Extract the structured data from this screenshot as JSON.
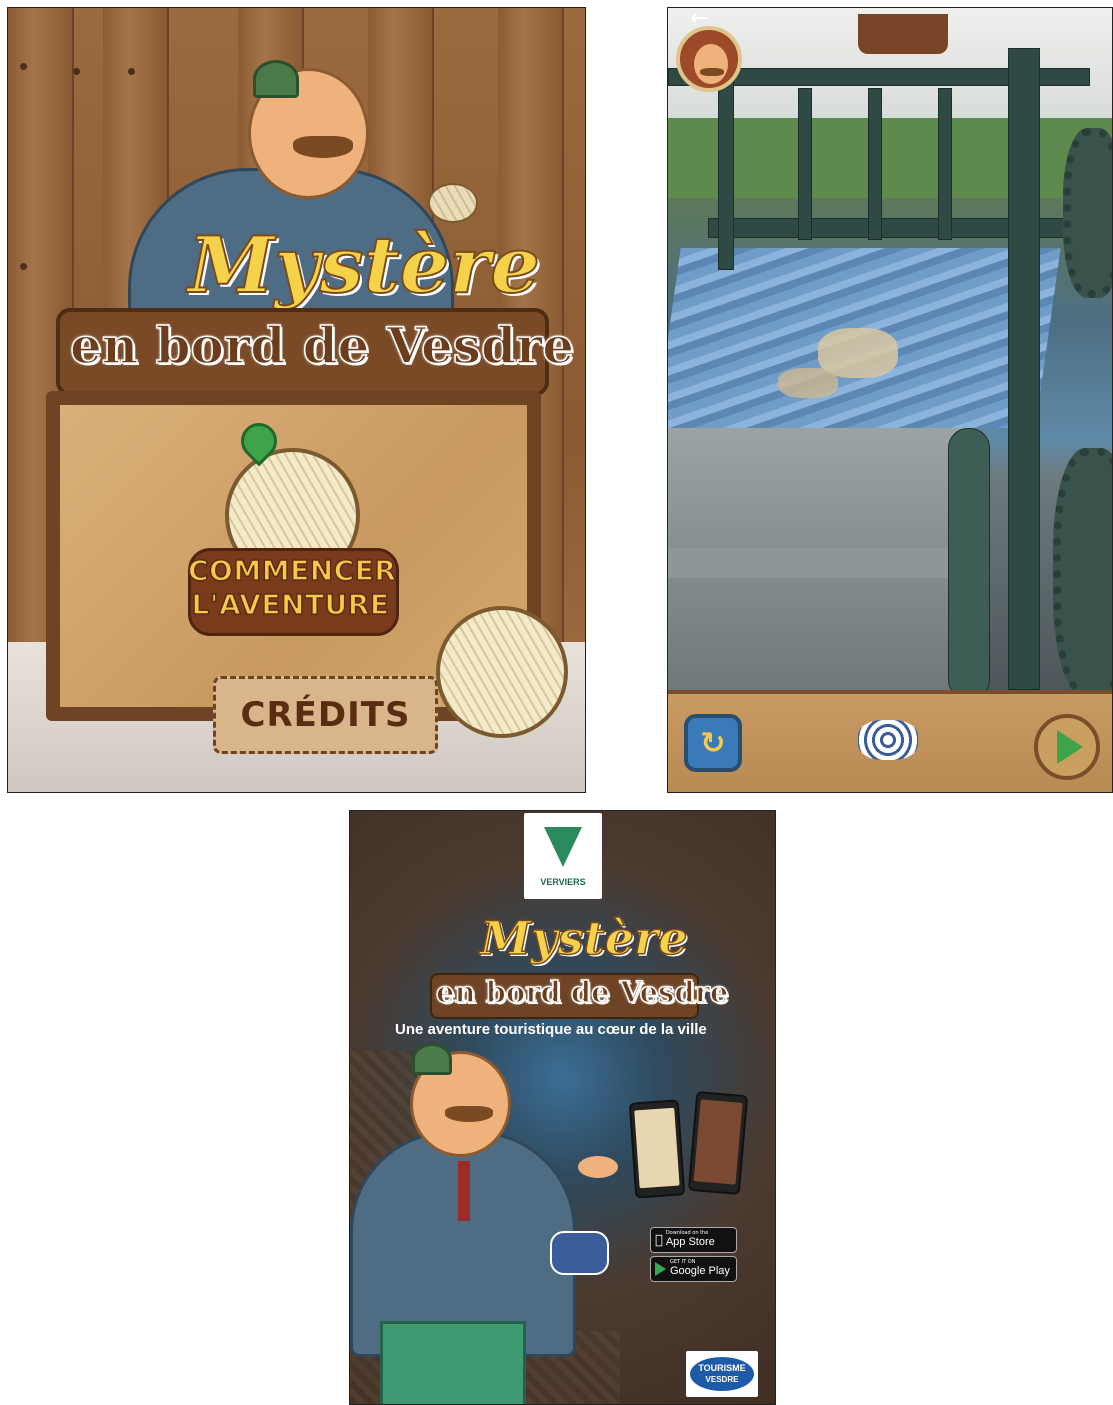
{
  "screen1": {
    "title_script": "Mystère",
    "title_sub": "en bord de Vesdre",
    "start_button_label_line1": "COMMENCER",
    "start_button_label_line2": "L'AVENTURE",
    "credits_label": "CRÉDITS"
  },
  "screen2": {
    "back_icon": "arrow-left-icon",
    "toolbar": {
      "restart_icon": "refresh-icon",
      "item_icon": "wool-icon",
      "next_icon": "play-icon"
    }
  },
  "poster": {
    "brand": "VERVIERS",
    "title_script": "Mystère",
    "title_sub": "en bord de Vesdre",
    "tagline": "Une aventure touristique au cœur de la ville",
    "app_store": {
      "top": "Download on the",
      "bottom": "App Store"
    },
    "google_play": {
      "top": "GET IT ON",
      "bottom": "Google Play"
    },
    "partner_logo": {
      "line1": "TOURISME",
      "line2": "VESDRE"
    }
  },
  "colors": {
    "title_yellow": "#f4d34a",
    "wood_dark": "#6e4424",
    "play_green": "#3ea34a",
    "poster_bg": "#3e2e24"
  }
}
